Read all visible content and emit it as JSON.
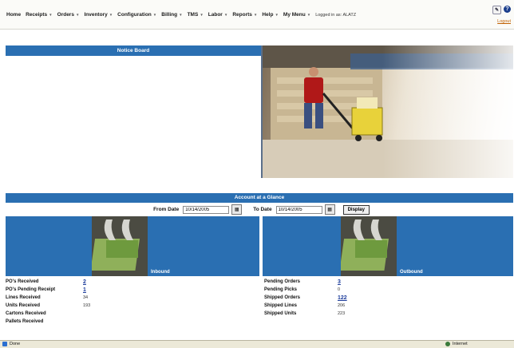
{
  "menu": {
    "items": [
      {
        "label": "Home",
        "caret": false
      },
      {
        "label": "Receipts",
        "caret": true
      },
      {
        "label": "Orders",
        "caret": true
      },
      {
        "label": "Inventory",
        "caret": true
      },
      {
        "label": "Configuration",
        "caret": true
      },
      {
        "label": "Billing",
        "caret": true
      },
      {
        "label": "TMS",
        "caret": true
      },
      {
        "label": "Labor",
        "caret": true
      },
      {
        "label": "Reports",
        "caret": true
      },
      {
        "label": "Help",
        "caret": true
      },
      {
        "label": "My Menu",
        "caret": true
      }
    ],
    "logged_in": "Logged in as: ALATZ",
    "logout": "Logout"
  },
  "notice_board": {
    "title": "Notice Board"
  },
  "glance": {
    "title": "Account at a Glance",
    "from_label": "From Date",
    "from_value": "10/14/2005",
    "to_label": "To Date",
    "to_value": "10/14/2005",
    "display_button": "Display"
  },
  "inbound": {
    "caption": "Inbound",
    "stats": [
      {
        "label": "PO's Received",
        "value": "2",
        "link": true
      },
      {
        "label": "PO's Pending Receipt",
        "value": "1",
        "link": true
      },
      {
        "label": "Lines Received",
        "value": "34",
        "link": false
      },
      {
        "label": "Units Received",
        "value": "193",
        "link": false
      },
      {
        "label": "Cartons Received",
        "value": "",
        "link": false
      },
      {
        "label": "Pallets Received",
        "value": "",
        "link": false
      }
    ]
  },
  "outbound": {
    "caption": "Outbound",
    "stats": [
      {
        "label": "Pending Orders",
        "value": "3",
        "link": true
      },
      {
        "label": "Pending Picks",
        "value": "0",
        "link": false
      },
      {
        "label": "Shipped Orders",
        "value": "122",
        "link": true
      },
      {
        "label": "Shipped Lines",
        "value": "206",
        "link": false
      },
      {
        "label": "Shipped Units",
        "value": "223",
        "link": false
      }
    ]
  },
  "statusbar": {
    "left": "Done",
    "right": "Internet"
  },
  "colors": {
    "header_blue": "#2a6fb2",
    "link_blue": "#1a3a9a"
  }
}
